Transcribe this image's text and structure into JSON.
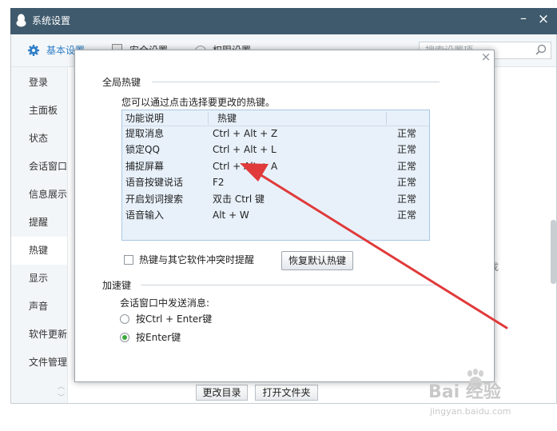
{
  "window": {
    "title": "系统设置",
    "minimize_glyph": "–",
    "close_glyph": "×"
  },
  "tabs": [
    {
      "label": "基本设置",
      "icon": "gear-icon",
      "active": true
    },
    {
      "label": "安全设置",
      "icon": "shield-icon",
      "active": false
    },
    {
      "label": "权限设置",
      "icon": "lock-icon",
      "active": false
    }
  ],
  "search": {
    "placeholder": "搜索设置项"
  },
  "sidebar": {
    "items": [
      {
        "label": "登录"
      },
      {
        "label": "主面板"
      },
      {
        "label": "状态"
      },
      {
        "label": "会话窗口"
      },
      {
        "label": "信息展示"
      },
      {
        "label": "提醒"
      },
      {
        "label": "热键",
        "active": true
      },
      {
        "label": "显示"
      },
      {
        "label": "声音"
      },
      {
        "label": "软件更新"
      },
      {
        "label": "文件管理"
      }
    ]
  },
  "background_buttons": {
    "change_dir": "更改目录",
    "open_folder": "打开文件夹"
  },
  "background_fragment": "成",
  "dialog": {
    "close_glyph": "×",
    "global_hotkey": {
      "title": "全局热键",
      "hint": "您可以通过点击选择要更改的热键。",
      "columns": {
        "func": "功能说明",
        "key": "热键"
      },
      "rows": [
        {
          "func": "提取消息",
          "key": "Ctrl + Alt + Z",
          "status": "正常"
        },
        {
          "func": "锁定QQ",
          "key": "Ctrl + Alt + L",
          "status": "正常"
        },
        {
          "func": "捕捉屏幕",
          "key": "Ctrl + Alt + A",
          "status": "正常"
        },
        {
          "func": "语音按键说话",
          "key": "F2",
          "status": "正常"
        },
        {
          "func": "开启划词搜索",
          "key": "双击 Ctrl 键",
          "status": "正常"
        },
        {
          "func": "语音输入",
          "key": "Alt + W",
          "status": "正常"
        }
      ],
      "conflict_checkbox": {
        "label": "热键与其它软件冲突时提醒",
        "checked": false
      },
      "restore_button": "恢复默认热键"
    },
    "accelerator": {
      "title": "加速键",
      "send_label": "会话窗口中发送消息:",
      "options": [
        {
          "label": "按Ctrl + Enter键",
          "selected": false
        },
        {
          "label": "按Enter键",
          "selected": true
        }
      ]
    }
  },
  "annotation": {
    "arrow_color": "#e03a3a"
  },
  "watermark": {
    "text": "Bai 经验",
    "sub": "jingyan.baidu.com"
  },
  "colors": {
    "titlebar": "#3f5a6d",
    "accent": "#2f7fc8",
    "table_bg": "#e8f1fa",
    "radio_selected": "#3aa83a"
  }
}
